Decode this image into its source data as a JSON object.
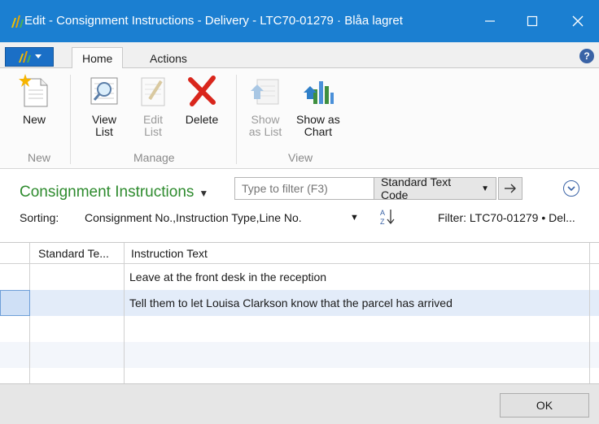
{
  "window": {
    "title": "Edit - Consignment Instructions - Delivery - LTC70-01279 · Blåa lagret"
  },
  "tabs": [
    {
      "label": "Home"
    },
    {
      "label": "Actions"
    }
  ],
  "help_label": "?",
  "ribbon": {
    "groups": [
      {
        "label": "New",
        "buttons": [
          {
            "label": "New",
            "icon": "new-document-icon"
          }
        ]
      },
      {
        "label": "Manage",
        "buttons": [
          {
            "label": "View\nList",
            "icon": "view-list-icon"
          },
          {
            "label": "Edit\nList",
            "icon": "edit-list-icon",
            "disabled": true
          },
          {
            "label": "Delete",
            "icon": "delete-icon"
          }
        ]
      },
      {
        "label": "View",
        "buttons": [
          {
            "label": "Show\nas List",
            "icon": "show-as-list-icon",
            "disabled": true
          },
          {
            "label": "Show as\nChart",
            "icon": "show-as-chart-icon"
          }
        ]
      }
    ]
  },
  "page": {
    "title": "Consignment Instructions",
    "filter_placeholder": "Type to filter (F3)",
    "filter_field": "Standard Text Code",
    "sorting_label": "Sorting:",
    "sorting_value": "Consignment No.,Instruction Type,Line No.",
    "filter_text": "Filter: LTC70-01279 • Del..."
  },
  "grid": {
    "columns": [
      "Standard Te...",
      "Instruction Text"
    ],
    "rows": [
      {
        "standard_text": "",
        "instruction_text": "Leave at the front desk in the reception"
      },
      {
        "standard_text": "",
        "instruction_text": "Tell them to let Louisa Clarkson know that the parcel has arrived"
      },
      {
        "standard_text": "",
        "instruction_text": ""
      },
      {
        "standard_text": "",
        "instruction_text": ""
      }
    ]
  },
  "footer": {
    "ok_label": "OK"
  },
  "colors": {
    "titlebar": "#1b7fd1",
    "page_title": "#2e8b2e",
    "delete_red": "#d9261c"
  }
}
